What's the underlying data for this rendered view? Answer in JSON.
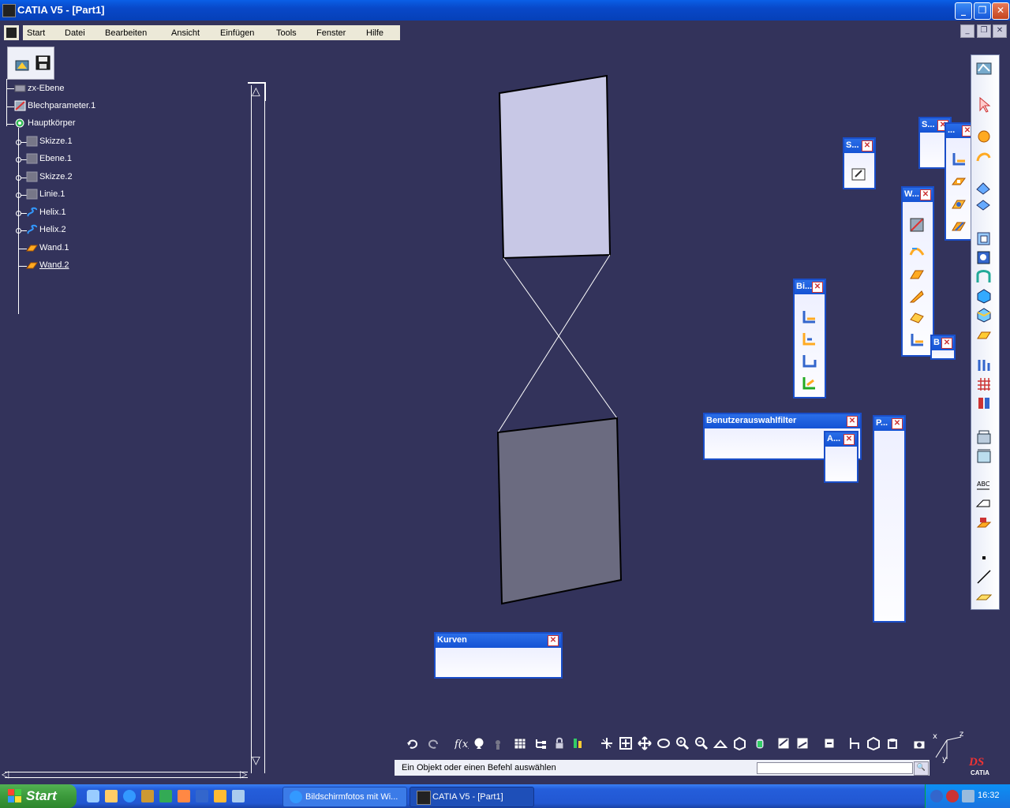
{
  "window": {
    "title": "CATIA V5 - [Part1]"
  },
  "menu": [
    "Start",
    "Datei",
    "Bearbeiten",
    "Ansicht",
    "Einfügen",
    "Tools",
    "Fenster",
    "Hilfe"
  ],
  "tree": [
    {
      "label": "zx-Ebene",
      "icon": "plane-icon"
    },
    {
      "label": "Blechparameter.1",
      "icon": "sheetmetal-params-icon"
    },
    {
      "label": "Hauptkörper",
      "icon": "body-icon"
    },
    {
      "label": "Skizze.1",
      "icon": "sketch-icon"
    },
    {
      "label": "Ebene.1",
      "icon": "plane-icon"
    },
    {
      "label": "Skizze.2",
      "icon": "sketch-icon"
    },
    {
      "label": "Linie.1",
      "icon": "line-icon"
    },
    {
      "label": "Helix.1",
      "icon": "helix-icon"
    },
    {
      "label": "Helix.2",
      "icon": "helix-icon"
    },
    {
      "label": "Wand.1",
      "icon": "wall-icon"
    },
    {
      "label": "Wand.2",
      "icon": "wall-icon"
    }
  ],
  "floating_toolbars": {
    "kurven": "Kurven",
    "benutzerauswahlfilter": "Benutzerauswahlfilter",
    "s1": "S...",
    "s2": "S...",
    "w": "W...",
    "bi": "Bi...",
    "a": "A...",
    "p": "P...",
    "b": "B",
    "dots": "..."
  },
  "status": {
    "message": "Ein Objekt oder einen Befehl auswählen",
    "command_value": ""
  },
  "taskbar": {
    "start": "Start",
    "apps": [
      {
        "label": "Bildschirmfotos mit Wi...",
        "icon": "ie-icon"
      },
      {
        "label": "CATIA V5 - [Part1]",
        "icon": "catia-icon"
      }
    ],
    "clock": "16:32"
  },
  "compass": {
    "x": "x",
    "y": "y",
    "z": "z"
  },
  "brand": {
    "logo_text": "CATIA"
  },
  "colors": {
    "background": "#33335b",
    "face_top": "#c8c8e6",
    "face_bottom": "#6b6b80",
    "toolbar_title": "#1553d4"
  }
}
